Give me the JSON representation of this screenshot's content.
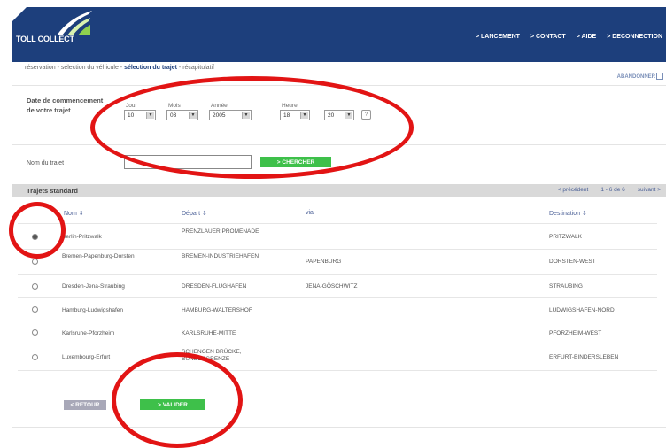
{
  "brand": {
    "logo_text": "TOLL COLLECT"
  },
  "topnav": [
    "> LANCEMENT",
    "> CONTACT",
    "> AIDE",
    "> DECONNECTION"
  ],
  "breadcrumb": {
    "before": "réservation - sélection du véhicule - ",
    "current": "sélection du trajet",
    "after": " - récapitulatif"
  },
  "change_link": "ABANDONNER",
  "date_section": {
    "label": "Date de commencement de votre trajet",
    "day": {
      "label": "Jour",
      "value": "10"
    },
    "month": {
      "label": "Mois",
      "value": "03"
    },
    "year": {
      "label": "Année",
      "value": "2005"
    },
    "time": {
      "label": "Heure",
      "hour": "18",
      "minute": "20"
    },
    "help": "?"
  },
  "trip_search": {
    "label": "Nom du trajet",
    "value": "",
    "button": "> CHERCHER"
  },
  "standard_trips": {
    "title": "Trajets standard",
    "pager": {
      "prev": "< précédent",
      "range": "1 - 6 de 6",
      "next": "suivant >"
    },
    "columns": [
      "Nom",
      "Départ",
      "via",
      "Destination"
    ],
    "rows": [
      {
        "name": "Berlin-Pritzwalk",
        "depart": "PRENZLAUER PROMENADE",
        "via": "",
        "dest": "PRITZWALK",
        "selected": true
      },
      {
        "name": "Bremen-Papenburg-Dorsten",
        "depart": "BREMEN-INDUSTRIEHAFEN",
        "via": "PAPENBURG",
        "dest": "DORSTEN-WEST",
        "selected": false
      },
      {
        "name": "Dresden-Jena-Straubing",
        "depart": "DRESDEN-FLUGHAFEN",
        "via": "JENA-GÖSCHWITZ",
        "dest": "STRAUBING",
        "selected": false
      },
      {
        "name": "Hamburg-Ludwigshafen",
        "depart": "HAMBURG-WALTERSHOF",
        "via": "",
        "dest": "LUDWIGSHAFEN-NORD",
        "selected": false
      },
      {
        "name": "Karlsruhe-Pforzheim",
        "depart": "KARLSRUHE-MITTE",
        "via": "",
        "dest": "PFORZHEIM-WEST",
        "selected": false
      },
      {
        "name": "Luxembourg-Erfurt",
        "depart": "SCHENGEN BRÜCKE, BUNDESGRENZE",
        "via": "",
        "dest": "ERFURT-BINDERSLEBEN",
        "selected": false
      }
    ]
  },
  "actions": {
    "back": "< RETOUR",
    "validate": "> VALIDER"
  },
  "colors": {
    "header": "#1d3f7c",
    "accent_green": "#3ec04a",
    "annotation_red": "#e21414"
  }
}
